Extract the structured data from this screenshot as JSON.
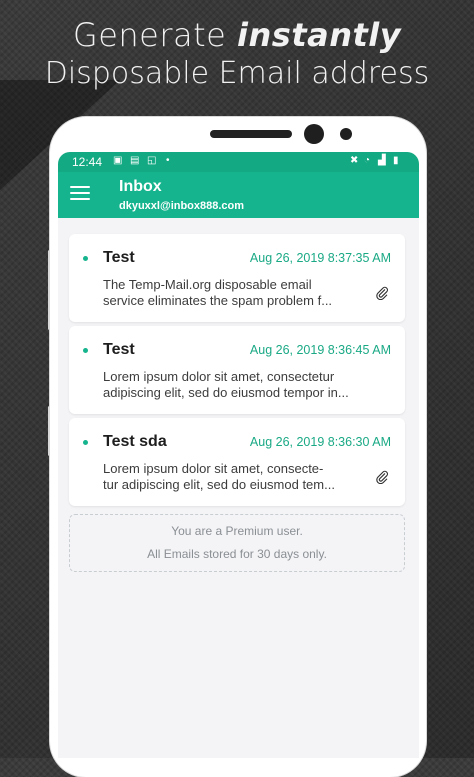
{
  "headline": {
    "line1_prefix": "Generate ",
    "line1_emphasis": "instantly",
    "line2": "Disposable Email address"
  },
  "statusbar": {
    "time": "12:44"
  },
  "appbar": {
    "title": "Inbox",
    "email": "dkyuxxl@inbox888.com"
  },
  "emails": [
    {
      "sender": "Test",
      "date": "Aug 26, 2019 8:37:35 AM",
      "preview_line1": "The Temp-Mail.org disposable email",
      "preview_line2": "service eliminates the spam problem f...",
      "has_attachment": true
    },
    {
      "sender": "Test",
      "date": "Aug 26, 2019 8:36:45 AM",
      "preview_line1": "Lorem ipsum dolor sit amet, consectetur",
      "preview_line2": "adipiscing elit, sed do eiusmod tempor in...",
      "has_attachment": false
    },
    {
      "sender": "Test sda",
      "date": "Aug 26, 2019 8:36:30 AM",
      "preview_line1": "Lorem ipsum dolor sit amet, consecte-",
      "preview_line2": "tur adipiscing elit, sed do eiusmod tem...",
      "has_attachment": true
    }
  ],
  "premium": {
    "line1": "You are a Premium user.",
    "line2": "All Emails stored for 30 days only."
  },
  "colors": {
    "accent": "#16b48e",
    "statusbar": "#13a982",
    "date_text": "#1aa985"
  }
}
